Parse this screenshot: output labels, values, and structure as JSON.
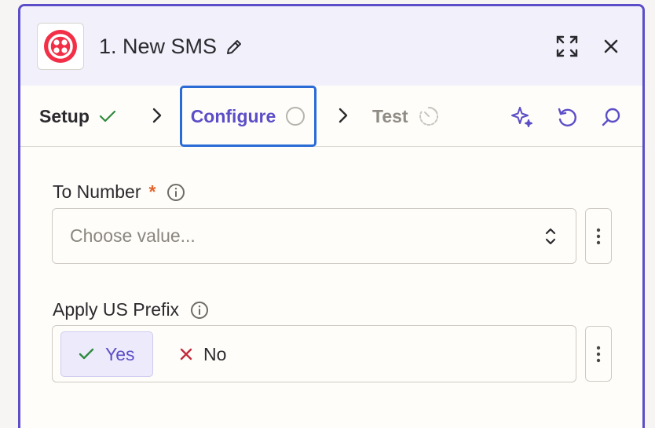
{
  "header": {
    "title": "1. New SMS",
    "app_icon": "twilio-logo",
    "brand_color": "#f22f46"
  },
  "tabs": [
    {
      "label": "Setup",
      "state": "complete"
    },
    {
      "label": "Configure",
      "state": "active"
    },
    {
      "label": "Test",
      "state": "disabled"
    }
  ],
  "fields": {
    "to_number": {
      "label": "To Number",
      "required_mark": "*",
      "placeholder": "Choose value..."
    },
    "apply_us_prefix": {
      "label": "Apply US Prefix",
      "options": [
        "Yes",
        "No"
      ],
      "selected": "Yes"
    }
  },
  "colors": {
    "accent": "#5b4ec8",
    "focus": "#2a6bd6",
    "success": "#2f8a3e",
    "danger": "#c4283b",
    "required": "#e5652b"
  }
}
